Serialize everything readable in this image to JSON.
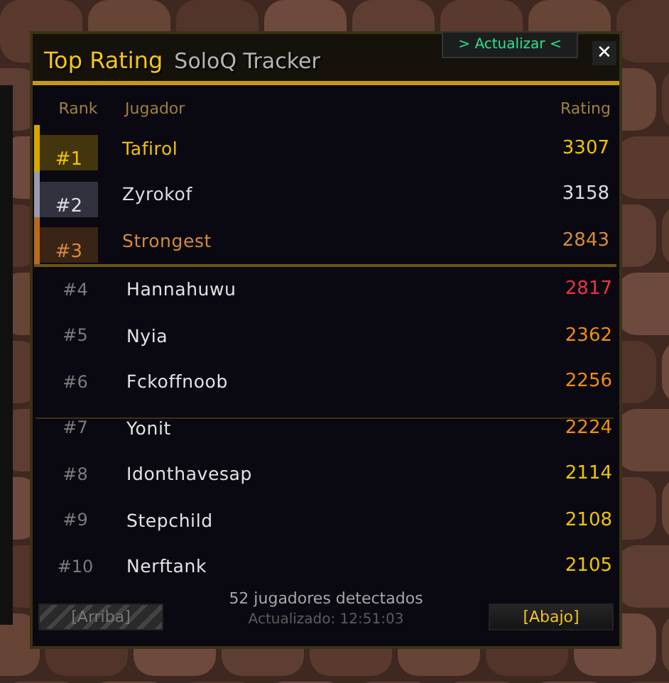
{
  "window": {
    "title": "Top Rating",
    "subtitle": "SoloQ Tracker"
  },
  "refresh_button": {
    "label": "> Actualizar <"
  },
  "close_button": {
    "label": "✕"
  },
  "columns": [
    "Rank",
    "Jugador",
    "Rating"
  ],
  "rows": [
    {
      "kind": "podium",
      "rank": "#1",
      "name": "Tafirol",
      "rating": "3307",
      "color": "#f2c200",
      "medal": {
        "color": "#d6a800"
      }
    },
    {
      "kind": "podium",
      "rank": "#2",
      "name": "Zyrokof",
      "rating": "3158",
      "color": "#dcdce4",
      "medal": {
        "color": "#9a9ab0"
      }
    },
    {
      "kind": "podium",
      "rank": "#3",
      "name": "Strongest",
      "rating": "2843",
      "color": "#d68a3c",
      "medal": {
        "color": "#b86a1c"
      }
    },
    {
      "kind": "regular",
      "rank": "#4",
      "name": "Hannahuwu",
      "rating": "2817",
      "color": "#ec3440"
    },
    {
      "kind": "regular",
      "rank": "#5",
      "name": "Nyia",
      "rating": "2362",
      "color": "#f28c12"
    },
    {
      "kind": "regular",
      "rank": "#6",
      "name": "Fckoffnoob",
      "rating": "2256",
      "color": "#f28c12"
    },
    {
      "kind": "regular",
      "rank": "#7",
      "name": "Yonit",
      "rating": "2224",
      "color": "#f28c12"
    },
    {
      "kind": "regular",
      "rank": "#8",
      "name": "Idonthavesap",
      "rating": "2114",
      "color": "#eec400"
    },
    {
      "kind": "regular",
      "rank": "#9",
      "name": "Stepchild",
      "rating": "2108",
      "color": "#eec400"
    },
    {
      "kind": "regular",
      "rank": "#10",
      "name": "Nerftank",
      "rating": "2105",
      "color": "#eec400"
    }
  ],
  "footer": {
    "count": "52 jugadores detectados",
    "updated": "Actualizado: 12:51:03"
  },
  "pager": [
    {
      "label": "[Arriba]",
      "disabled": true
    },
    {
      "label": "[Abajo]",
      "disabled": false
    }
  ]
}
